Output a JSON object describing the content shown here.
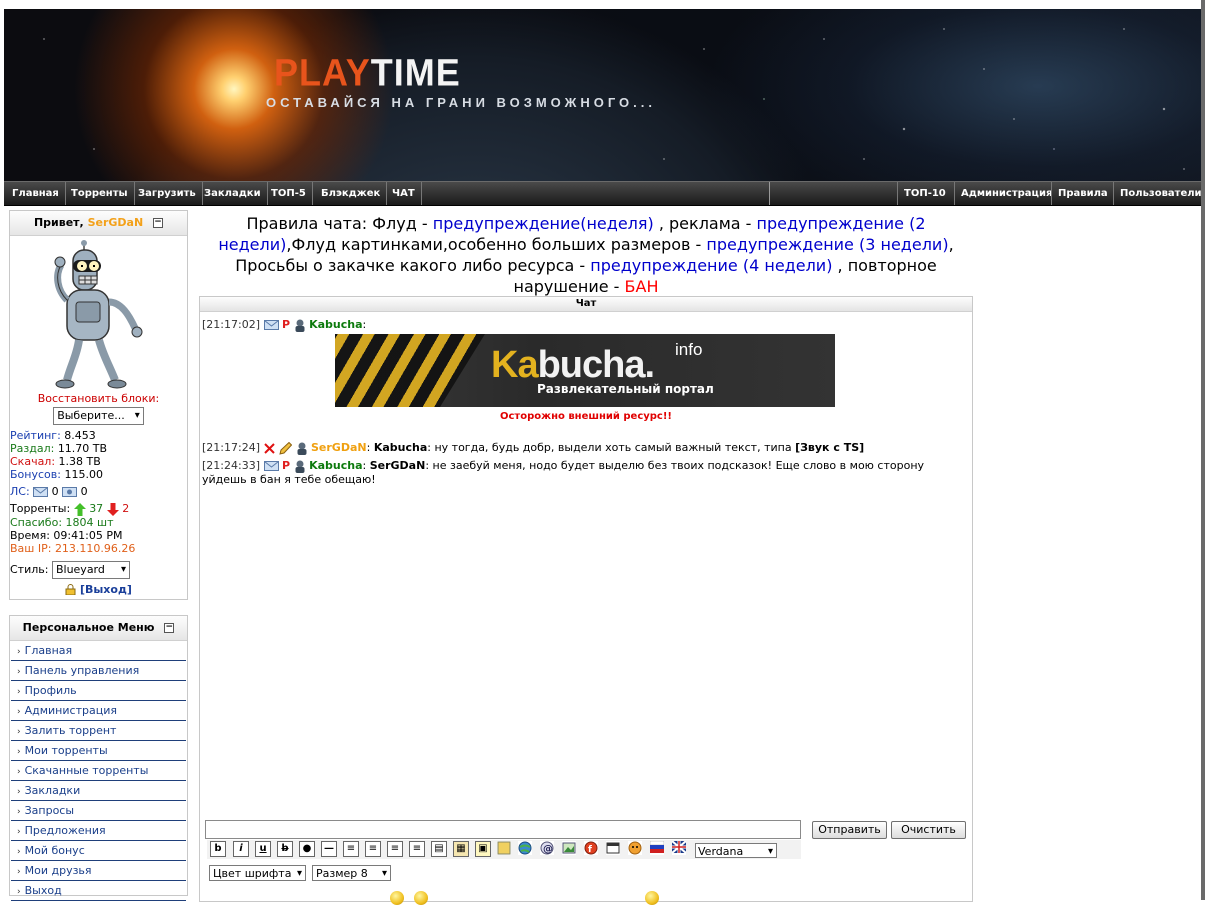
{
  "site": {
    "logo_play": "PLAY",
    "logo_time": "TIME",
    "slogan": "ОСТАВАЙСЯ НА ГРАНИ ВОЗМОЖНОГО..."
  },
  "nav": {
    "left": [
      "Главная",
      "Торренты",
      "Загрузить",
      "Закладки",
      "ТОП-5",
      "Блэкджек",
      "ЧАТ"
    ],
    "right": [
      "ТОП-10",
      "Администрация",
      "Правила",
      "Пользователи"
    ]
  },
  "userbox": {
    "greeting": "Привет,",
    "username": "SerGDaN",
    "restore_label": "Восстановить блоки:",
    "restore_select": "Выберите...",
    "rating_label": "Рейтинг:",
    "rating": "8.453",
    "uploaded_label": "Раздал:",
    "uploaded": "11.70 TB",
    "downloaded_label": "Скачал:",
    "downloaded": "1.38 TB",
    "bonus_label": "Бонусов:",
    "bonus": "115.00",
    "pm_label": "ЛС:",
    "pm_inbox": "0",
    "pm_outbox": "0",
    "torrents_label": "Торренты:",
    "seeding": "37",
    "leeching": "2",
    "thanks_label": "Спасибо:",
    "thanks": "1804 шт",
    "time_label": "Время:",
    "time": "09:41:05 PM",
    "ip_label": "Ваш IP:",
    "ip": "213.110.96.26",
    "style_label": "Стиль:",
    "style_value": "Blueyard",
    "logout": "[Выход]"
  },
  "personal_menu": {
    "title": "Персональное Меню",
    "items": [
      "Главная",
      "Панель управления",
      "Профиль",
      "Администрация",
      "Залить торрент",
      "Мои торренты",
      "Скачанные торренты",
      "Закладки",
      "Запросы",
      "Предложения",
      "Мой бонус",
      "Мои друзья",
      "Выход"
    ]
  },
  "rules": {
    "p1": "Правила чата: Флуд - ",
    "w1": "предупреждение(неделя)",
    "p2": " , реклама - ",
    "w2": "предупреждение (2 недели)",
    "p3": ",Флуд картинками,особенно больших размеров - ",
    "w3": "предупреждение (3 недели)",
    "p4": ", Просьбы о закачке какого либо ресурса - ",
    "w4": "предупреждение (4 недели)",
    "p5": " , повторное нарушение - ",
    "ban": "БАН"
  },
  "chat": {
    "title": "Чат",
    "messages": [
      {
        "time": "[21:17:02]",
        "p": "P",
        "nick": "Kabucha",
        "sep": ":",
        "text": ""
      },
      {
        "time": "[21:17:24]",
        "nick": "SerGDaN",
        "sep": ":",
        "to": "Kabucha",
        "text": ": ну тогда, будь добр, выдели хоть самый важный текст, типа ",
        "bold": "[Звук с TS]"
      },
      {
        "time": "[21:24:33]",
        "p": "P",
        "nick": "Kabucha",
        "sep": ":",
        "to": "SerGDaN",
        "text": ": не заебуй меня, нодо будет выделю без твоих подсказок! Еще слово в мою сторону уйдешь в бан я тебе обещаю!"
      }
    ],
    "ad": {
      "kabu": "Ka",
      "bucha": "bucha.",
      "info": "info",
      "portal": "Развлекательный портал"
    },
    "warning": "Осторожно внешний ресурс!!",
    "send_button": "Отправить",
    "clear_button": "Очистить",
    "font_select": "Verdana",
    "color_select": "Цвет шрифта",
    "size_select": "Размер 8"
  },
  "colors": {
    "accent_orange": "#e8541c",
    "link_blue": "#0000cc",
    "ban_red": "#ff0000",
    "nick_green": "#0d7a0d"
  }
}
